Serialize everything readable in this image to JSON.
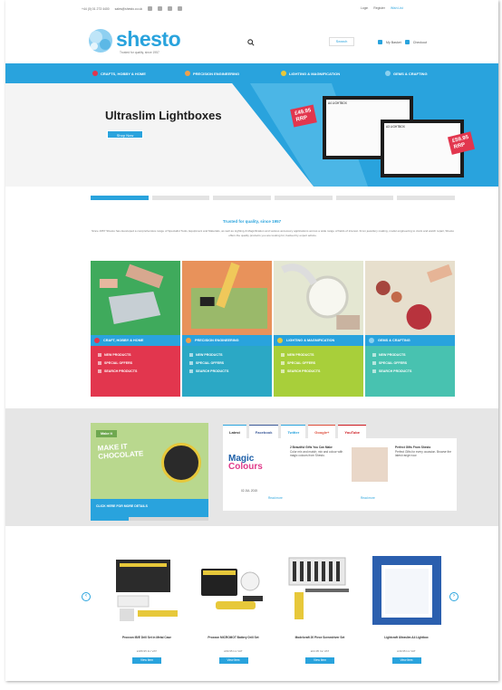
{
  "topbar": {
    "phone": "+44 (0) 01 273 4400",
    "email": "sales@shesto.co.uk",
    "login": "Login",
    "register": "Register",
    "wishlist": "Wish List"
  },
  "header": {
    "logo_text": "shesto",
    "tagline": "Trusted for quality, since 1957",
    "search_button": "Search",
    "basket_label": "My Basket",
    "checkout_label": "Checkout"
  },
  "nav": {
    "items": [
      {
        "label": "Crafts, Hobby & Home",
        "color": "#e2364e"
      },
      {
        "label": "Precision Engineering",
        "color": "#f0a04b"
      },
      {
        "label": "Lighting & Magnification",
        "color": "#e7c83a"
      },
      {
        "label": "Gems & Crafting",
        "color": "#8bd0ef"
      }
    ]
  },
  "hero": {
    "title": "Ultraslim Lightboxes",
    "button": "Shop Now",
    "box1_label": "A4 LIGHTBOX",
    "box2_label": "A3 LIGHTBOX",
    "price1": "£49.95",
    "price1_sub": "RRP",
    "price2": "£59.95",
    "price2_sub": "RRP"
  },
  "intro": {
    "title": "Trusted for quality, since 1957",
    "text": "Since 1957 Shesto has developed a comprehensive range of Specialist Tools, Equipment and Materials, as well as Lighting & Magnification and various accessory applications across a wide range of fields of interest. From jewellery making, model engineering to clock and watch repair, Shesto offers the quality products you are looking for, backed by expert advice."
  },
  "tiles": [
    {
      "heading": "Craft, Hobby & Home",
      "icon_color": "#e2364e",
      "body_color": "#e2364e",
      "img_color": "#3faa5c",
      "links": [
        "New Products",
        "Special Offers",
        "Search Products"
      ]
    },
    {
      "heading": "Precision Engineering",
      "icon_color": "#f0a04b",
      "body_color": "#2ba8c5",
      "img_color": "#e8925b",
      "links": [
        "New Products",
        "Special Offers",
        "Search Products"
      ]
    },
    {
      "heading": "Lighting & Magnification",
      "icon_color": "#e7c83a",
      "body_color": "#a8cf3a",
      "img_color": "#e4e7d2",
      "links": [
        "New Products",
        "Special Offers",
        "Search Products"
      ]
    },
    {
      "heading": "Gems & Crafting",
      "icon_color": "#8bd0ef",
      "body_color": "#48c2b0",
      "img_color": "#e7dfcd",
      "links": [
        "New Products",
        "Special Offers",
        "Search Products"
      ]
    }
  ],
  "promo": {
    "flag": "Make It",
    "headline_1": "MAKE IT",
    "headline_2": "CHOCOLATE",
    "footer": "CLICK HERE FOR MORE DETAILS"
  },
  "social": {
    "tabs": [
      "Latest",
      "Facebook",
      "Twitter",
      "Google+",
      "YouTube"
    ],
    "brand_1": "Magic",
    "brand_2": "Colours",
    "post1_title": "2 Beautiful Gifts You Can Make",
    "post1_text": "Color mix and match; mix and colour with magic colours from Shesto.",
    "post1_date": "02 JUL 2015",
    "post1_more": "Read more",
    "post2_title": "Perfect Gifts From Shesto",
    "post2_text": "Perfect Gifts for every occasion. Browse the latest range now.",
    "post2_more": "Read more"
  },
  "products": [
    {
      "name": "Proxxon IB/E Drill Set in Metal Case",
      "price": "£189.95 Inc VAT",
      "button": "View Item"
    },
    {
      "name": "Proxxon MICROMOT Battery Drill Set",
      "price": "£99.95 Inc VAT",
      "button": "View Item"
    },
    {
      "name": "Modelcraft 20 Piece Screwdriver Set",
      "price": "£24.95 Inc VAT",
      "button": "View Item"
    },
    {
      "name": "Lightcraft Ultraslim A4 Lightbox",
      "price": "£49.95 Inc VAT",
      "button": "View Item"
    }
  ],
  "colors": {
    "accent": "#29a3dd",
    "grey_band": "#e6e6e6"
  }
}
